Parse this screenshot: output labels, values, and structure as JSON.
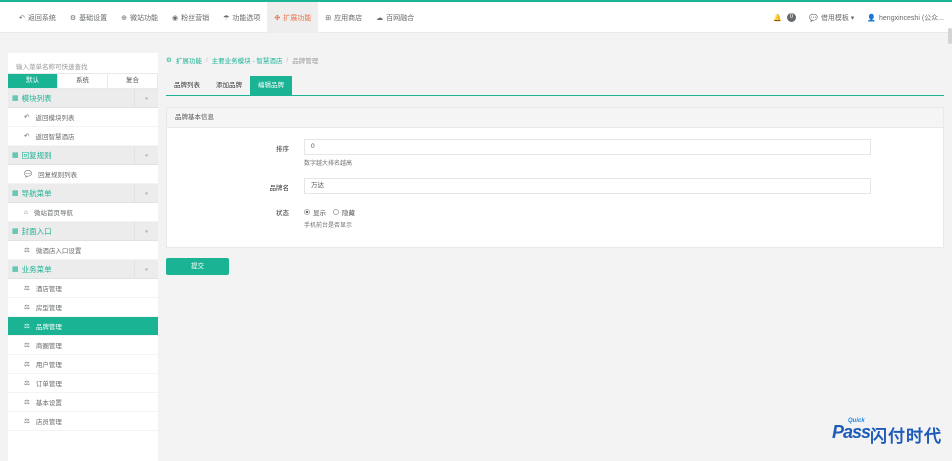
{
  "topnav": [
    {
      "icon": "↶",
      "icon_name": "undo-icon",
      "label": "返回系统",
      "active": false
    },
    {
      "icon": "⚙",
      "icon_name": "gear-icon",
      "label": "基础设置",
      "active": false
    },
    {
      "icon": "⊕",
      "icon_name": "globe-icon",
      "label": "微站功能",
      "active": false
    },
    {
      "icon": "◉",
      "icon_name": "user-icon",
      "label": "粉丝营销",
      "active": false
    },
    {
      "icon": "☂",
      "icon_name": "umbrella-icon",
      "label": "功能选项",
      "active": false
    },
    {
      "icon": "✤",
      "icon_name": "cubes-icon",
      "label": "扩展功能",
      "active": true
    },
    {
      "icon": "⊞",
      "icon_name": "cart-icon",
      "label": "应用商店",
      "active": false
    },
    {
      "icon": "☁",
      "icon_name": "cloud-icon",
      "label": "百网融合",
      "active": false
    }
  ],
  "right_nav": {
    "notify_icon": "🔔",
    "notify_count": "0",
    "service_icon": "💬",
    "service_label": "借用模板 ▾",
    "user_icon": "👤",
    "user_label": "hengxinceshi (公众..."
  },
  "sidebar": {
    "search_placeholder": "输入菜单名称可快速查找",
    "tabs": [
      {
        "label": "默认",
        "active": true
      },
      {
        "label": "系统",
        "active": false
      },
      {
        "label": "复合",
        "active": false
      }
    ],
    "groups": [
      {
        "title": "模块列表",
        "items": [
          {
            "icon": "↶",
            "icon_name": "reply-icon",
            "label": "返回模块列表",
            "active": false
          },
          {
            "icon": "↶",
            "icon_name": "reply-icon",
            "label": "返回智慧酒店",
            "active": false
          }
        ]
      },
      {
        "title": "回复规则",
        "items": [
          {
            "icon": "💬",
            "icon_name": "comments-icon",
            "label": "回复规则列表",
            "active": false
          }
        ]
      },
      {
        "title": "导航菜单",
        "items": [
          {
            "icon": "⌂",
            "icon_name": "home-icon",
            "label": "微站首页导航",
            "active": false
          }
        ]
      },
      {
        "title": "封面入口",
        "items": [
          {
            "icon": "⚖",
            "icon_name": "puzzle-icon",
            "label": "微酒店入口设置",
            "active": false
          }
        ]
      },
      {
        "title": "业务菜单",
        "items": [
          {
            "icon": "⚖",
            "icon_name": "puzzle-icon",
            "label": "酒店管理",
            "active": false
          },
          {
            "icon": "⚖",
            "icon_name": "puzzle-icon",
            "label": "房型管理",
            "active": false
          },
          {
            "icon": "⚖",
            "icon_name": "puzzle-icon",
            "label": "品牌管理",
            "active": true
          },
          {
            "icon": "⚖",
            "icon_name": "puzzle-icon",
            "label": "商圈管理",
            "active": false
          },
          {
            "icon": "⚖",
            "icon_name": "puzzle-icon",
            "label": "用户管理",
            "active": false
          },
          {
            "icon": "⚖",
            "icon_name": "puzzle-icon",
            "label": "订单管理",
            "active": false
          },
          {
            "icon": "⚖",
            "icon_name": "puzzle-icon",
            "label": "基本设置",
            "active": false
          },
          {
            "icon": "⚖",
            "icon_name": "puzzle-icon",
            "label": "店员管理",
            "active": false
          }
        ]
      }
    ]
  },
  "breadcrumb": {
    "icon": "⚙",
    "items": [
      "扩展功能",
      "主要业务模块 - 智慧酒店",
      "品牌管理"
    ]
  },
  "page_tabs": [
    {
      "label": "品牌列表",
      "active": false
    },
    {
      "label": "添加品牌",
      "active": false
    },
    {
      "label": "编辑品牌",
      "active": true
    }
  ],
  "form": {
    "panel_title": "品牌基本信息",
    "sort_label": "排序",
    "sort_value": "0",
    "sort_help": "数字越大排名越高",
    "name_label": "品牌名",
    "name_value": "万达",
    "status_label": "状态",
    "status_options": [
      {
        "label": "显示",
        "checked": true
      },
      {
        "label": "隐藏",
        "checked": false
      }
    ],
    "status_help": "手机前台是否显示",
    "submit_label": "提交"
  },
  "watermark": {
    "quick": "Quick",
    "pass": "Pass",
    "cn": "闪付时代"
  }
}
